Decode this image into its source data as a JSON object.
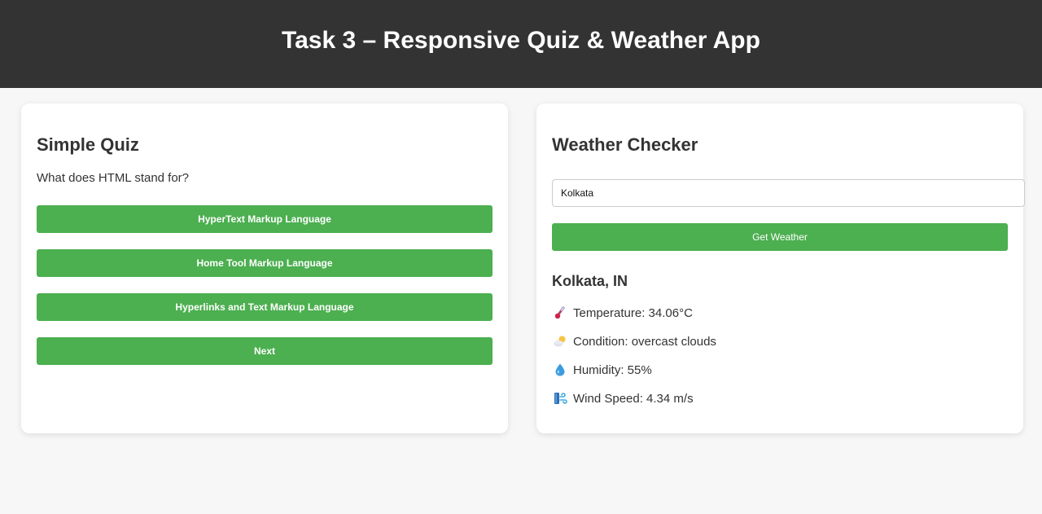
{
  "header": {
    "title": "Task 3 – Responsive Quiz & Weather App"
  },
  "quiz": {
    "title": "Simple Quiz",
    "question": "What does HTML stand for?",
    "options": [
      "HyperText Markup Language",
      "Home Tool Markup Language",
      "Hyperlinks and Text Markup Language"
    ],
    "next_label": "Next"
  },
  "weather": {
    "title": "Weather Checker",
    "city_value": "Kolkata",
    "button_label": "Get Weather",
    "location": "Kolkata, IN",
    "rows": [
      {
        "icon": "thermometer-icon",
        "text": "Temperature: 34.06°C"
      },
      {
        "icon": "cloud-sun-icon",
        "text": "Condition: overcast clouds"
      },
      {
        "icon": "droplet-icon",
        "text": "Humidity: 55%"
      },
      {
        "icon": "wind-icon",
        "text": "Wind Speed: 4.34 m/s"
      }
    ]
  },
  "colors": {
    "header_bg": "#333333",
    "accent_green": "#4caf50",
    "page_bg": "#f7f7f7",
    "card_bg": "#ffffff"
  }
}
